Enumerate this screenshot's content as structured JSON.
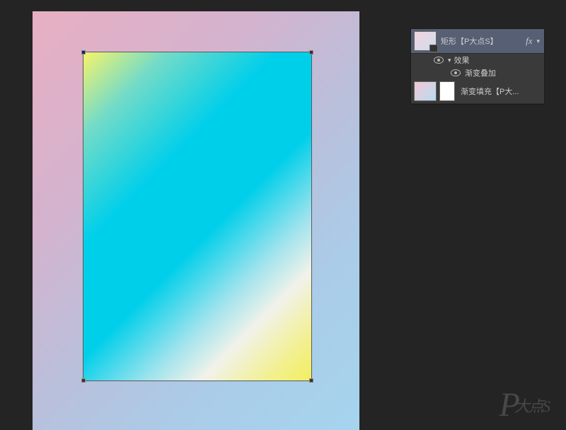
{
  "canvas": {
    "shape_name": "矩形【P大点S】"
  },
  "layers": {
    "layer1": {
      "name": "矩形【P大点S】",
      "fx_label": "fx",
      "collapse_glyph": "▾",
      "effects_label": "效果",
      "effect_item": "渐变叠加",
      "effect_collapse": "▾"
    },
    "layer2": {
      "name": "渐变填充【P大..."
    }
  },
  "watermark": {
    "main": "P",
    "suffix": "大点S"
  }
}
